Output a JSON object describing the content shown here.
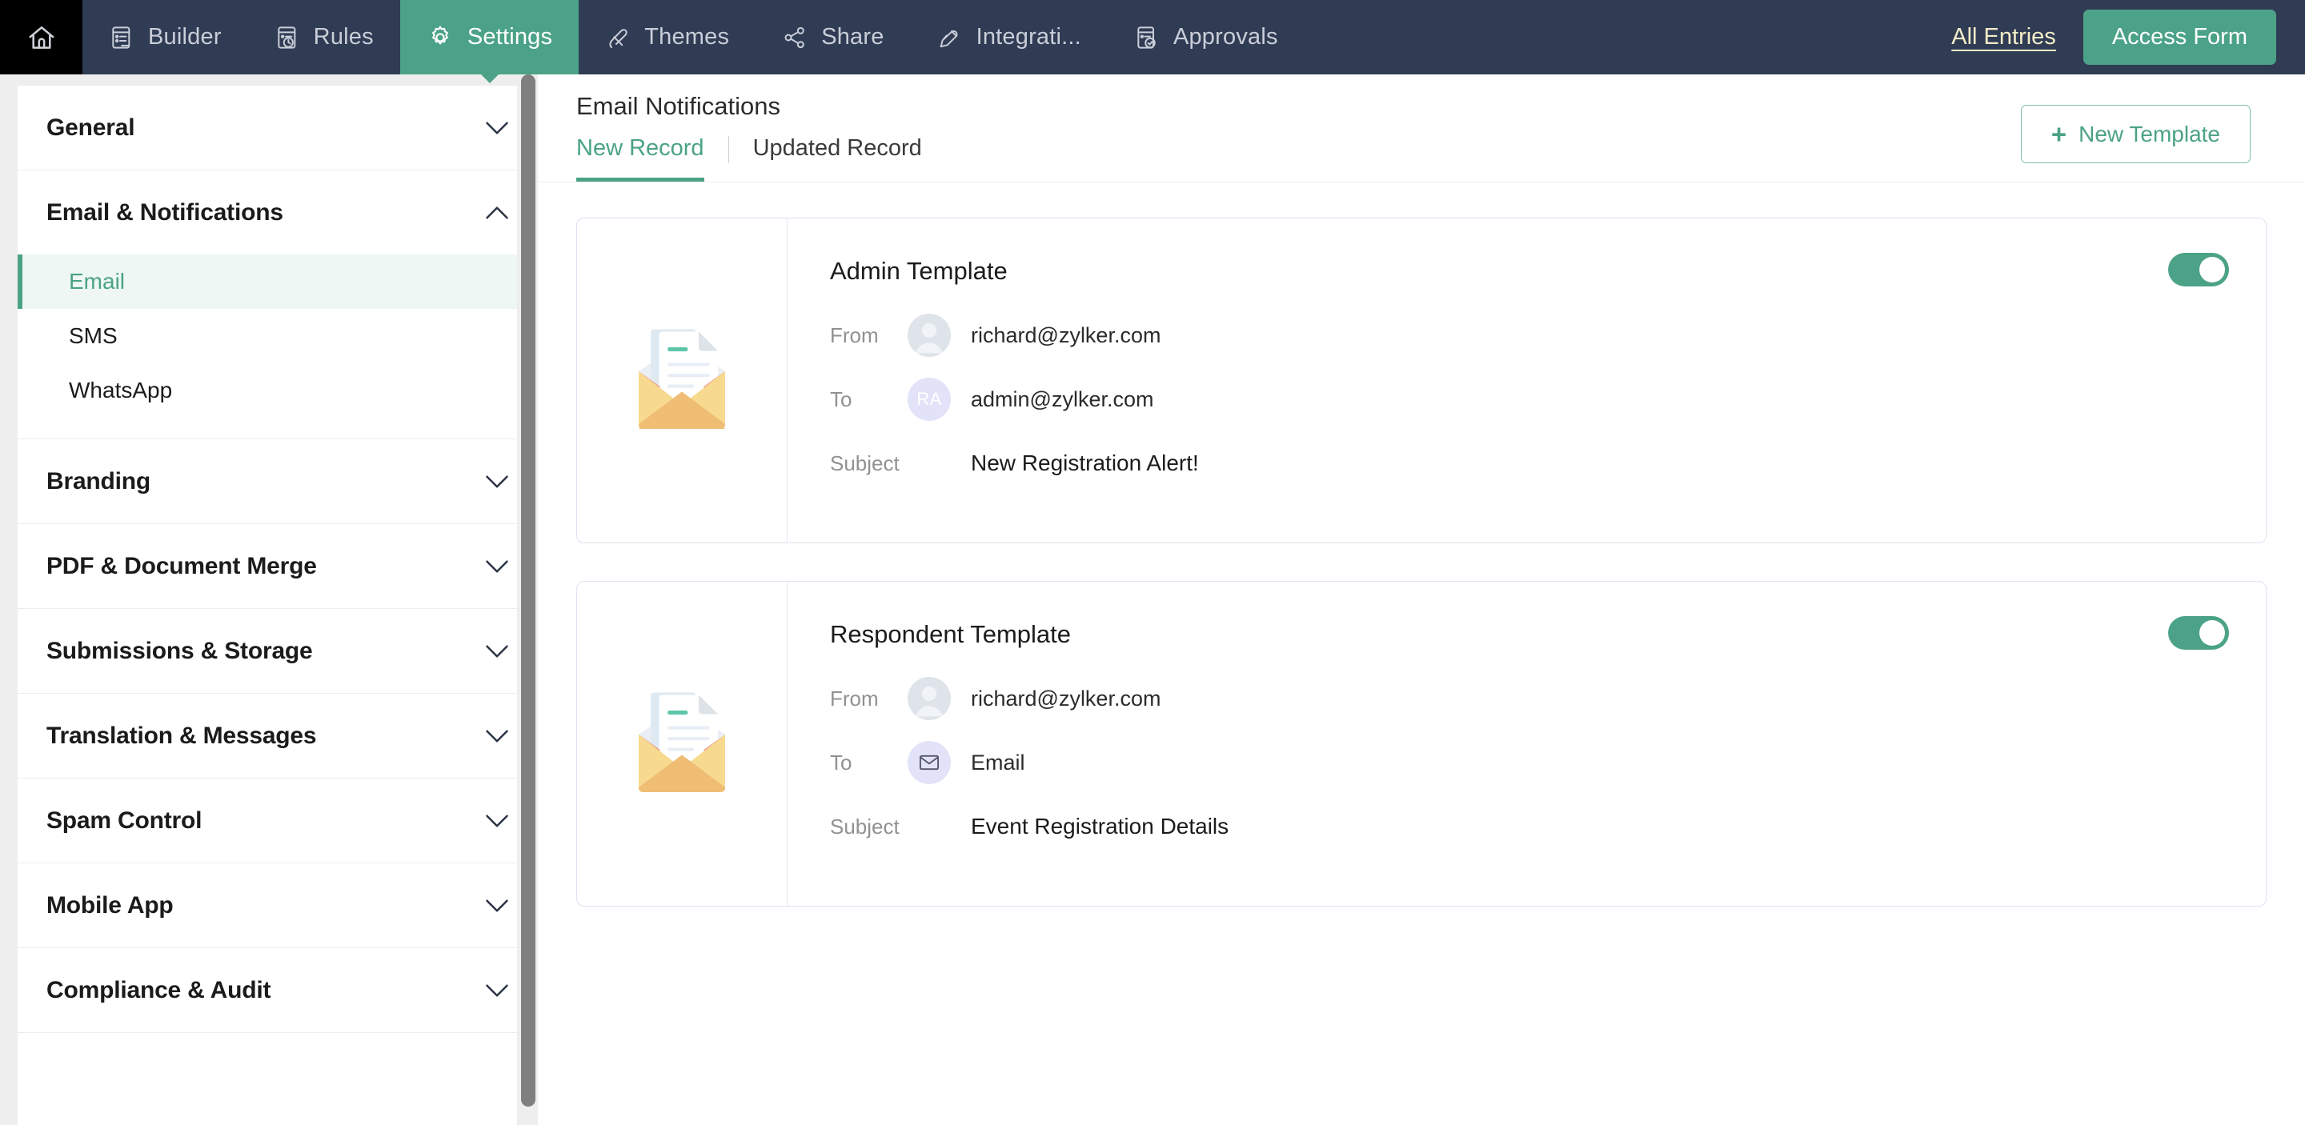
{
  "topnav": {
    "home_icon": "home-icon",
    "items": [
      {
        "label": "Builder",
        "icon": "builder-icon",
        "active": false
      },
      {
        "label": "Rules",
        "icon": "rules-icon",
        "active": false
      },
      {
        "label": "Settings",
        "icon": "gear-icon",
        "active": true
      },
      {
        "label": "Themes",
        "icon": "themes-icon",
        "active": false
      },
      {
        "label": "Share",
        "icon": "share-icon",
        "active": false
      },
      {
        "label": "Integrati...",
        "icon": "integrations-icon",
        "active": false
      },
      {
        "label": "Approvals",
        "icon": "approvals-icon",
        "active": false
      }
    ],
    "all_entries_label": "All Entries",
    "access_form_label": "Access Form",
    "colors": {
      "bar_bg": "#303b54",
      "home_bg": "#000000",
      "accent": "#4ba287",
      "link": "#f3ecc8"
    }
  },
  "sidebar": {
    "groups": [
      {
        "title": "General",
        "expanded": false,
        "chevron": "chevron-down-icon",
        "items": []
      },
      {
        "title": "Email & Notifications",
        "expanded": true,
        "chevron": "chevron-up-icon",
        "items": [
          {
            "label": "Email",
            "active": true
          },
          {
            "label": "SMS",
            "active": false
          },
          {
            "label": "WhatsApp",
            "active": false
          }
        ]
      },
      {
        "title": "Branding",
        "expanded": false,
        "chevron": "chevron-down-icon",
        "items": []
      },
      {
        "title": "PDF & Document Merge",
        "expanded": false,
        "chevron": "chevron-down-icon",
        "items": []
      },
      {
        "title": "Submissions & Storage",
        "expanded": false,
        "chevron": "chevron-down-icon",
        "items": []
      },
      {
        "title": "Translation & Messages",
        "expanded": false,
        "chevron": "chevron-down-icon",
        "items": []
      },
      {
        "title": "Spam Control",
        "expanded": false,
        "chevron": "chevron-down-icon",
        "items": []
      },
      {
        "title": "Mobile App",
        "expanded": false,
        "chevron": "chevron-down-icon",
        "items": []
      },
      {
        "title": "Compliance & Audit",
        "expanded": false,
        "chevron": "chevron-down-icon",
        "items": []
      }
    ],
    "active_item_color": "#4ba287"
  },
  "main": {
    "page_title": "Email Notifications",
    "tabs": [
      {
        "label": "New Record",
        "active": true
      },
      {
        "label": "Updated Record",
        "active": false
      }
    ],
    "new_template_label": "New Template",
    "new_template_plus": "+",
    "templates": [
      {
        "name": "Admin Template",
        "illustration": "open-envelope-letter-icon",
        "enabled": true,
        "rows": [
          {
            "label": "From",
            "avatar_type": "photo",
            "avatar_text": "",
            "value": "richard@zylker.com"
          },
          {
            "label": "To",
            "avatar_type": "initials",
            "avatar_text": "RA",
            "value": "admin@zylker.com"
          },
          {
            "label": "Subject",
            "avatar_type": "none",
            "avatar_text": "",
            "value": "New Registration Alert!"
          }
        ]
      },
      {
        "name": "Respondent Template",
        "illustration": "open-envelope-letter-icon",
        "enabled": true,
        "rows": [
          {
            "label": "From",
            "avatar_type": "photo",
            "avatar_text": "",
            "value": "richard@zylker.com"
          },
          {
            "label": "To",
            "avatar_type": "mail",
            "avatar_text": "",
            "value": "Email"
          },
          {
            "label": "Subject",
            "avatar_type": "none",
            "avatar_text": "",
            "value": "Event Registration Details"
          }
        ]
      }
    ]
  }
}
